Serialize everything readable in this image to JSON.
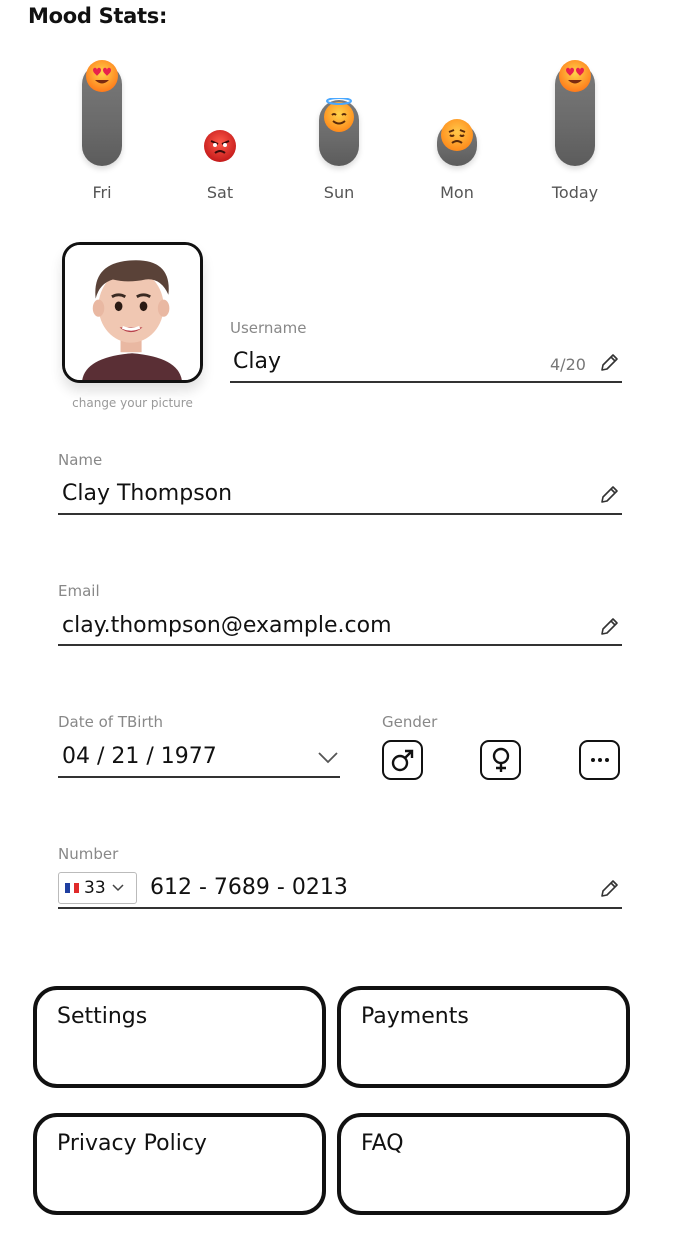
{
  "mood_stats": {
    "title": "Mood Stats:",
    "days": [
      {
        "label": "Fri",
        "level": 1.0,
        "emoji": "heart-eyes-emoji-icon"
      },
      {
        "label": "Sat",
        "level": 0.0,
        "emoji": "angry-emoji-icon"
      },
      {
        "label": "Sun",
        "level": 0.55,
        "emoji": "halo-smile-emoji-icon"
      },
      {
        "label": "Mon",
        "level": 0.25,
        "emoji": "sad-emoji-icon"
      },
      {
        "label": "Today",
        "level": 1.0,
        "emoji": "heart-eyes-emoji-icon"
      }
    ]
  },
  "profile": {
    "avatar_icon": "user-avatar-icon",
    "change_picture": "change your picture",
    "username": {
      "label": "Username",
      "value": "Clay",
      "counter": "4/20"
    },
    "name": {
      "label": "Name",
      "value": "Clay Thompson"
    },
    "email": {
      "label": "Email",
      "value": "clay.thompson@example.com"
    },
    "birth": {
      "label": "Date of TBirth",
      "value": "04 / 21 / 1977"
    },
    "gender": {
      "label": "Gender",
      "options": [
        "male-icon",
        "female-icon",
        "more-icon"
      ]
    },
    "number": {
      "label": "Number",
      "country_code": "33",
      "country_flag": "france-flag-icon",
      "value": "612 - 7689 - 0213"
    }
  },
  "menu": {
    "items": [
      "Settings",
      "Payments",
      "Privacy Policy",
      "FAQ"
    ]
  },
  "colors": {
    "accent": "#111111",
    "bar": "#6a6a6a",
    "label": "#888888"
  }
}
